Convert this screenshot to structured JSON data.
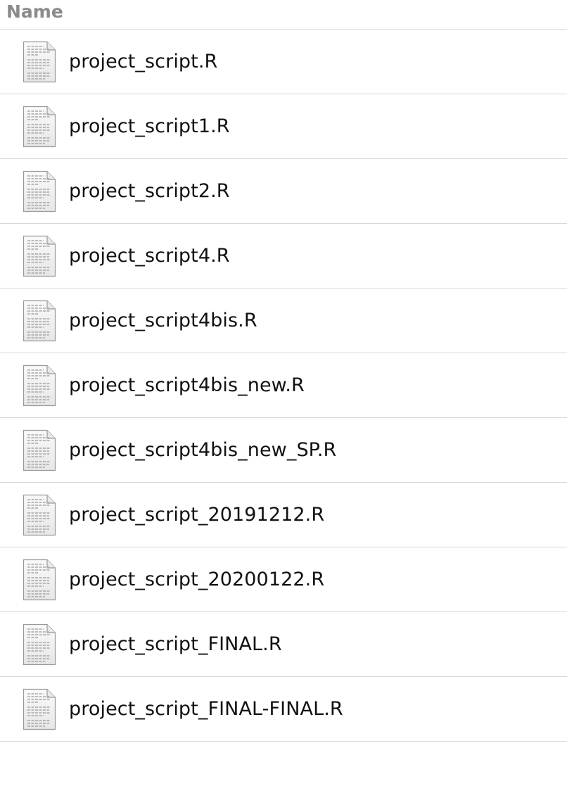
{
  "header": {
    "name_label": "Name"
  },
  "files": [
    {
      "name": "project_script.R",
      "icon": "text-file-icon"
    },
    {
      "name": "project_script1.R",
      "icon": "text-file-icon"
    },
    {
      "name": "project_script2.R",
      "icon": "text-file-icon"
    },
    {
      "name": "project_script4.R",
      "icon": "text-file-icon"
    },
    {
      "name": "project_script4bis.R",
      "icon": "text-file-icon"
    },
    {
      "name": "project_script4bis_new.R",
      "icon": "text-file-icon"
    },
    {
      "name": "project_script4bis_new_SP.R",
      "icon": "text-file-icon"
    },
    {
      "name": "project_script_20191212.R",
      "icon": "text-file-icon"
    },
    {
      "name": "project_script_20200122.R",
      "icon": "text-file-icon"
    },
    {
      "name": "project_script_FINAL.R",
      "icon": "text-file-icon"
    },
    {
      "name": "project_script_FINAL-FINAL.R",
      "icon": "text-file-icon"
    }
  ],
  "colors": {
    "header_text": "#8a8a8a",
    "divider": "#d8d8d8",
    "file_text": "#111111",
    "icon_paper": "#f4f4f4",
    "icon_outline": "#9a9a9a",
    "icon_lines": "#a8a8a8"
  }
}
